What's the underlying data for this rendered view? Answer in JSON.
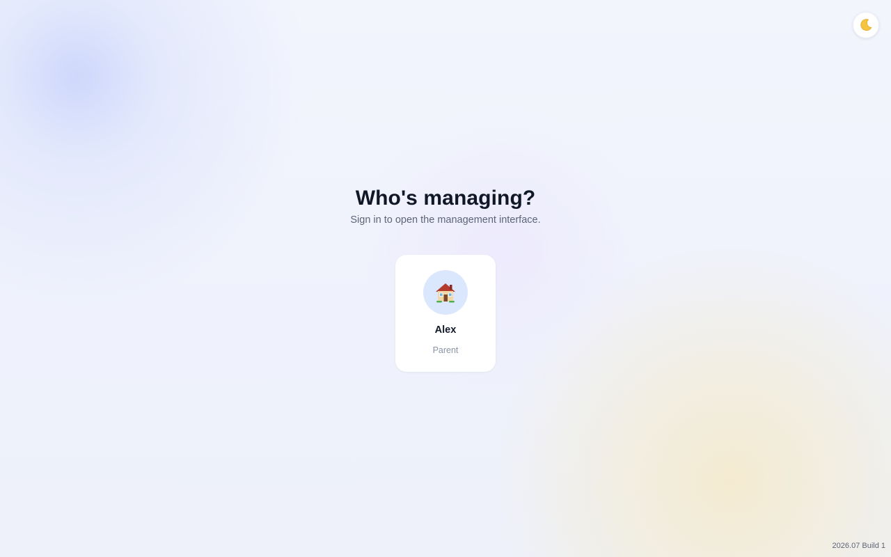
{
  "header": {
    "theme_toggle_icon": "moon-icon"
  },
  "main": {
    "title": "Who's managing?",
    "subtitle": "Sign in to open the management interface."
  },
  "profiles": [
    {
      "name": "Alex",
      "role": "Parent",
      "avatar_icon": "house-icon",
      "avatar_color": "#dbe7fd"
    }
  ],
  "footer": {
    "version": "2026.07 Build 1"
  },
  "colors": {
    "title": "#101828",
    "subtitle": "#5b6577",
    "moon": "#f5c542"
  }
}
